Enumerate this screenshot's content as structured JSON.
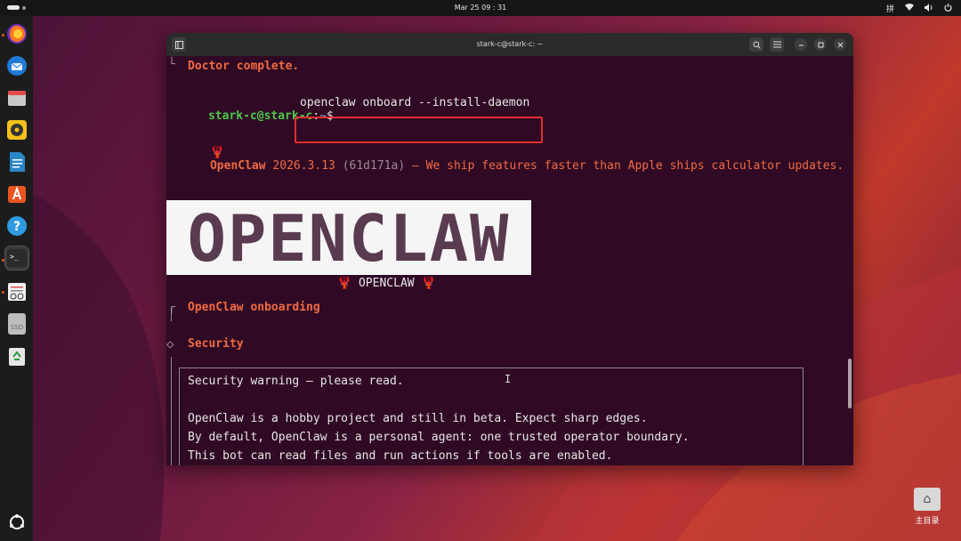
{
  "topbar": {
    "clock": "Mar 25  09 : 31",
    "input_method": "拼",
    "icons": [
      "network-icon",
      "volume-icon",
      "power-icon"
    ]
  },
  "dock": {
    "apps": [
      "firefox",
      "thunderbird",
      "files",
      "rhythmbox",
      "libreoffice-writer",
      "app-center",
      "help",
      "terminal",
      "text-editor",
      "ssd",
      "trash"
    ],
    "ssd_label": "SSD",
    "terminal_glyph": ">_"
  },
  "window": {
    "title": "stark-c@stark-c: ~"
  },
  "terminal": {
    "line_doctor": "Doctor complete.",
    "prompt_user": "stark-c@stark-c",
    "prompt_sep": ":",
    "prompt_path": "~",
    "prompt_dollar": "$",
    "command": "openclaw onboard --install-daemon",
    "version_prefix": "OpenClaw",
    "version": "2026.3.13",
    "commit": "(61d171a)",
    "tagline": "— We ship features faster than Apple ships calculator updates.",
    "banner_text": "OPENCLAW",
    "center_title": "OPENCLAW",
    "onboarding": "OpenClaw onboarding",
    "security_heading": "Security",
    "security_warning": "Security warning — please read.",
    "cursor_glyph": "I",
    "body_lines": [
      "OpenClaw is a hobby project and still in beta. Expect sharp edges.",
      "By default, OpenClaw is a personal agent: one trusted operator boundary.",
      "This bot can read files and run actions if tools are enabled."
    ]
  },
  "desktop": {
    "home_label": "主目录"
  },
  "colors": {
    "terminal_bg": "#300a24",
    "accent_orange": "#f06a42",
    "prompt_green": "#4ec94e",
    "highlight_red": "#e03030"
  }
}
